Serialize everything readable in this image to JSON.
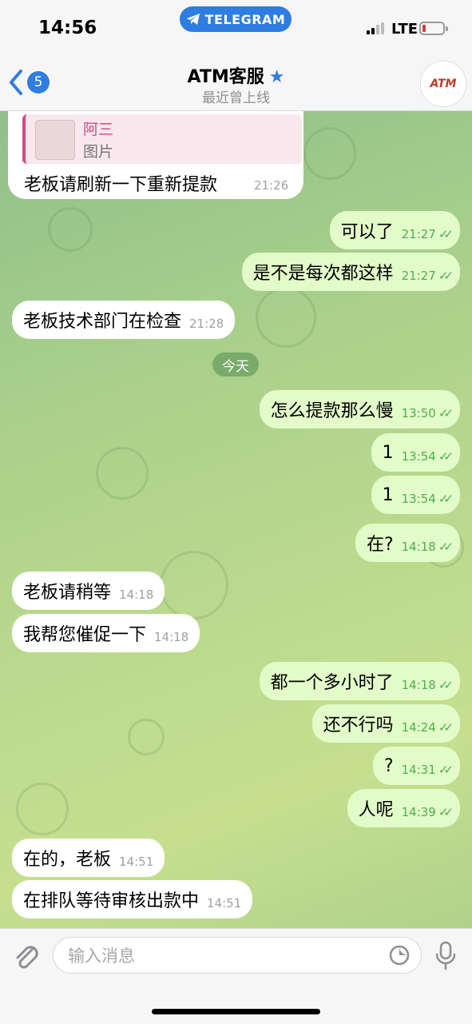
{
  "status": {
    "time": "14:56",
    "banner": "TELEGRAM",
    "network": "LTE",
    "accent": "#2f7de1",
    "battery_color": "#e53935"
  },
  "header": {
    "back_count": "5",
    "title": "ATM客服",
    "subtitle": "最近曾上线",
    "avatar_text": "ATM"
  },
  "reply": {
    "name": "阿三",
    "type": "图片",
    "text": "老板请刷新一下重新提款",
    "time": "21:26"
  },
  "date_divider": "今天",
  "messages": [
    {
      "dir": "out",
      "text": "可以了",
      "time": "21:27"
    },
    {
      "dir": "out",
      "text": "是不是每次都这样",
      "time": "21:27"
    },
    {
      "dir": "in",
      "text": "老板技术部门在检查",
      "time": "21:28"
    },
    {
      "dir": "out",
      "text": "怎么提款那么慢",
      "time": "13:50"
    },
    {
      "dir": "out",
      "text": "1",
      "time": "13:54"
    },
    {
      "dir": "out",
      "text": "1",
      "time": "13:54"
    },
    {
      "dir": "out",
      "text": "在?",
      "time": "14:18"
    },
    {
      "dir": "in",
      "text": "老板请稍等",
      "time": "14:18"
    },
    {
      "dir": "in",
      "text": "我帮您催促一下",
      "time": "14:18"
    },
    {
      "dir": "out",
      "text": "都一个多小时了",
      "time": "14:18"
    },
    {
      "dir": "out",
      "text": "还不行吗",
      "time": "14:24"
    },
    {
      "dir": "out",
      "text": "?",
      "time": "14:31"
    },
    {
      "dir": "out",
      "text": "人呢",
      "time": "14:39"
    },
    {
      "dir": "in",
      "text": "在的，老板",
      "time": "14:51"
    },
    {
      "dir": "in",
      "text": "在排队等待审核出款中",
      "time": "14:51"
    }
  ],
  "composer": {
    "placeholder": "输入消息"
  }
}
